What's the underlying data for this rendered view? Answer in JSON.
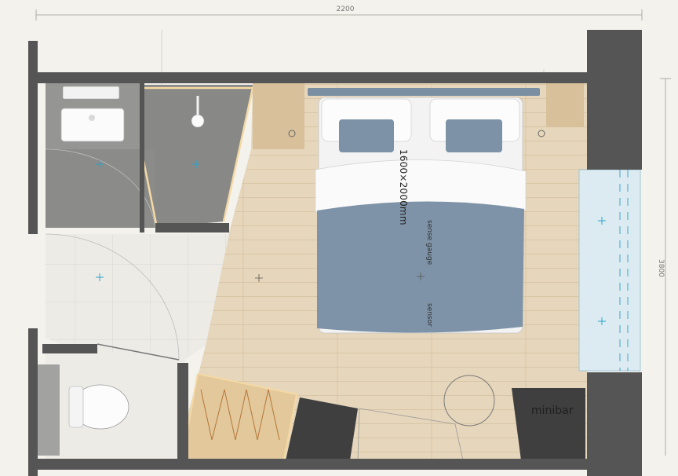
{
  "dimensions": {
    "top": "2200",
    "right": "3800"
  },
  "bed": {
    "size_label": "1600×2000mm",
    "note_1": "sense gauge",
    "note_2": "sensor"
  },
  "furniture": {
    "minibar_label": "minibar"
  },
  "colors": {
    "wall": "#555555",
    "floor_wood": "#e8d9c0",
    "bathroom_tile": "#8d8d8b",
    "marble": "#ecebe6",
    "duvet": "#7e93a7",
    "glass": "#dcebf1",
    "led_strip": "#f5d9a4"
  }
}
